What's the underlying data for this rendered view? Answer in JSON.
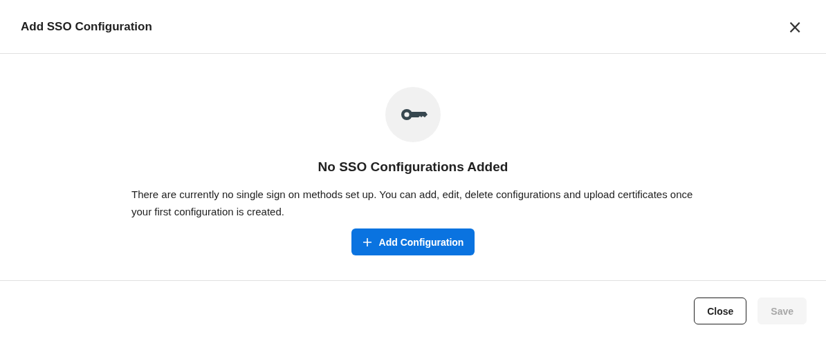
{
  "dialog": {
    "title": "Add SSO Configuration",
    "close_label": "×"
  },
  "empty_state": {
    "heading": "No SSO Configurations Added",
    "message": "There are currently no single sign on methods set up. You can add, edit, delete configurations and upload certificates once your first configuration is created.",
    "action": {
      "label": "Add Configuration"
    }
  },
  "footer_buttons": [
    {
      "label": "Close",
      "disabled": false
    },
    {
      "label": "Save",
      "disabled": true
    }
  ]
}
